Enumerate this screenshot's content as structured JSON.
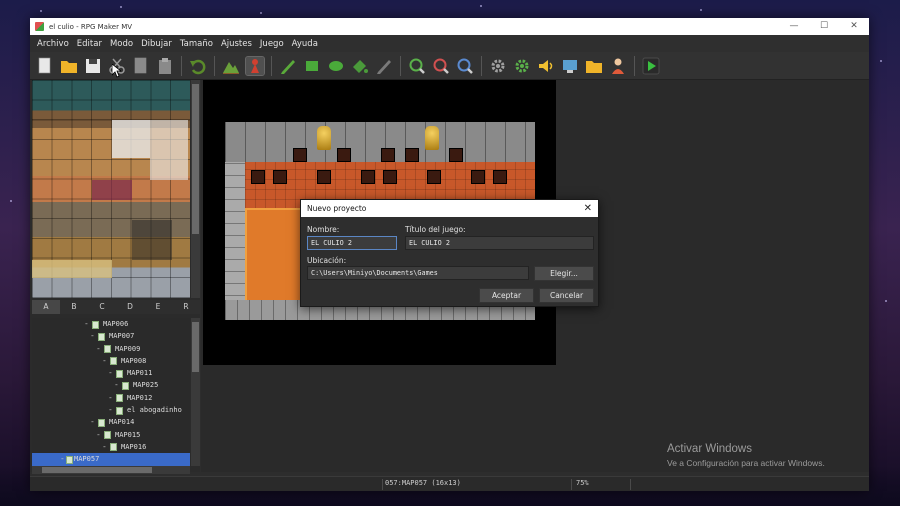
{
  "window": {
    "title": "el culio - RPG Maker MV",
    "controls": [
      "—",
      "☐",
      "✕"
    ]
  },
  "menu": [
    "Archivo",
    "Editar",
    "Modo",
    "Dibujar",
    "Tamaño",
    "Ajustes",
    "Juego",
    "Ayuda"
  ],
  "toolbar": [
    {
      "name": "new-project-icon",
      "color": "#e8e8e8",
      "shape": "doc"
    },
    {
      "name": "open-project-icon",
      "color": "#f0b429",
      "shape": "folder"
    },
    {
      "name": "save-project-icon",
      "color": "#e8e8e8",
      "shape": "disk"
    },
    {
      "name": "cut-icon",
      "color": "#9a9a9a",
      "shape": "scissors"
    },
    {
      "name": "copy-icon",
      "color": "#8a8a8a",
      "shape": "doc"
    },
    {
      "name": "paste-icon",
      "color": "#8a8a8a",
      "shape": "clip"
    },
    {
      "sep": true
    },
    {
      "name": "undo-icon",
      "color": "#5a8a2a",
      "shape": "undo"
    },
    {
      "sep": true
    },
    {
      "name": "map-mode-icon",
      "color": "#6aa03a",
      "shape": "mountain"
    },
    {
      "name": "event-mode-icon",
      "color": "#d04030",
      "shape": "pawn",
      "active": true
    },
    {
      "sep": true
    },
    {
      "name": "pencil-icon",
      "color": "#5aaa3a",
      "shape": "pencil"
    },
    {
      "name": "rectangle-icon",
      "color": "#4aaa3a",
      "shape": "rect"
    },
    {
      "name": "ellipse-icon",
      "color": "#4aaa3a",
      "shape": "ellipse"
    },
    {
      "name": "fill-icon",
      "color": "#4a9a3a",
      "shape": "fill"
    },
    {
      "name": "shadow-pen-icon",
      "color": "#7a7a7a",
      "shape": "pencil"
    },
    {
      "sep": true
    },
    {
      "name": "zoom-in-icon",
      "color": "#5ab04a",
      "shape": "zoom"
    },
    {
      "name": "zoom-out-icon",
      "color": "#d05050",
      "shape": "zoom"
    },
    {
      "name": "zoom-actual-icon",
      "color": "#5a8ad0",
      "shape": "zoom"
    },
    {
      "sep": true
    },
    {
      "name": "database-icon",
      "color": "#a0a0a0",
      "shape": "gear"
    },
    {
      "name": "plugin-manager-icon",
      "color": "#5ab04a",
      "shape": "gear"
    },
    {
      "name": "sound-test-icon",
      "color": "#f0c030",
      "shape": "speaker"
    },
    {
      "name": "event-searcher-icon",
      "color": "#5aa0d0",
      "shape": "monitor"
    },
    {
      "name": "resource-manager-icon",
      "color": "#f0b429",
      "shape": "folder"
    },
    {
      "name": "character-generator-icon",
      "color": "#e05a3a",
      "shape": "person"
    },
    {
      "sep": true
    },
    {
      "name": "playtest-icon",
      "color": "#3ac040",
      "shape": "play"
    }
  ],
  "tileset_tabs": [
    "A",
    "B",
    "C",
    "D",
    "E",
    "R"
  ],
  "map_tree": [
    {
      "label": "MAP006",
      "indent": 0,
      "sel": false
    },
    {
      "label": "MAP007",
      "indent": 1,
      "sel": false
    },
    {
      "label": "MAP009",
      "indent": 2,
      "sel": false
    },
    {
      "label": "MAP008",
      "indent": 3,
      "sel": false
    },
    {
      "label": "MAP011",
      "indent": 4,
      "sel": false
    },
    {
      "label": "MAP025",
      "indent": 5,
      "sel": false
    },
    {
      "label": "MAP012",
      "indent": 4,
      "sel": false
    },
    {
      "label": "el abogadinho",
      "indent": 4,
      "sel": false
    },
    {
      "label": "MAP014",
      "indent": 1,
      "sel": false
    },
    {
      "label": "MAP015",
      "indent": 2,
      "sel": false
    },
    {
      "label": "MAP016",
      "indent": 3,
      "sel": false
    },
    {
      "label": "MAP057",
      "indent": 0,
      "sel": true
    }
  ],
  "dialog": {
    "title": "Nuevo proyecto",
    "close": "✕",
    "name_label": "Nombre:",
    "name_value": "EL CULIO 2",
    "game_title_label": "Título del juego:",
    "game_title_value": "EL CULIO 2",
    "location_label": "Ubicación:",
    "location_value": "C:\\Users\\Miniyo\\Documents\\Games",
    "choose_button": "Elegir...",
    "accept_button": "Aceptar",
    "cancel_button": "Cancelar"
  },
  "status": {
    "map_info": "057:MAP057 (16x13)",
    "zoom": "75%"
  },
  "watermark": {
    "title": "Activar Windows",
    "subtitle": "Ve a Configuración para activar Windows."
  }
}
